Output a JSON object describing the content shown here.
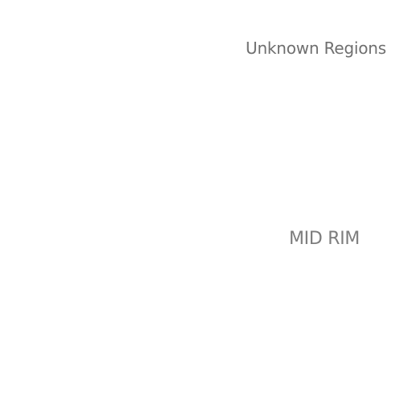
{
  "map": {
    "background_color": "#ffffff",
    "regions": [
      {
        "label": "Unknown Regions",
        "color": "#6f6f6f"
      },
      {
        "label": "MID RIM",
        "color": "#7d7d7d"
      }
    ]
  }
}
